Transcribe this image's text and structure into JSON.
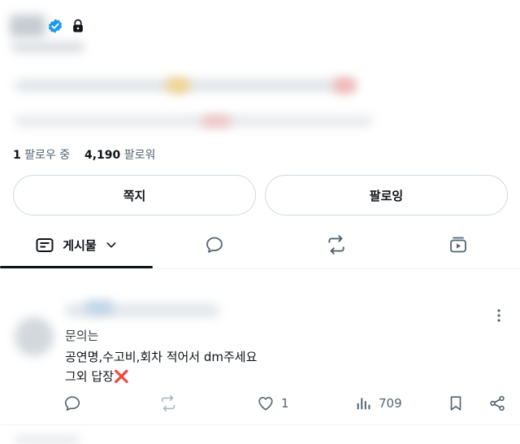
{
  "profile": {
    "following_count": "1",
    "following_label": "팔로우 중",
    "followers_count": "4,190",
    "followers_label": "팔로워"
  },
  "buttons": {
    "message_label": "쪽지",
    "following_label": "팔로잉"
  },
  "tabs": {
    "posts_label": "게시물"
  },
  "post": {
    "lines": [
      "문의는",
      "공연명,수고비,회차 적어서 dm주세요",
      "그외 답장❌"
    ],
    "likes": "1",
    "views": "709"
  },
  "colors": {
    "text": "#0f1419",
    "muted": "#536471",
    "border": "#cfd9de",
    "verified": "#1d9bf0"
  },
  "icons": [
    "verified-badge-icon",
    "lock-icon",
    "posts-feed-icon",
    "chevron-down-icon",
    "reply-bubble-icon",
    "repost-icon",
    "media-play-icon",
    "more-vertical-icon",
    "like-heart-icon",
    "views-bar-icon",
    "bookmark-icon",
    "share-icon"
  ]
}
